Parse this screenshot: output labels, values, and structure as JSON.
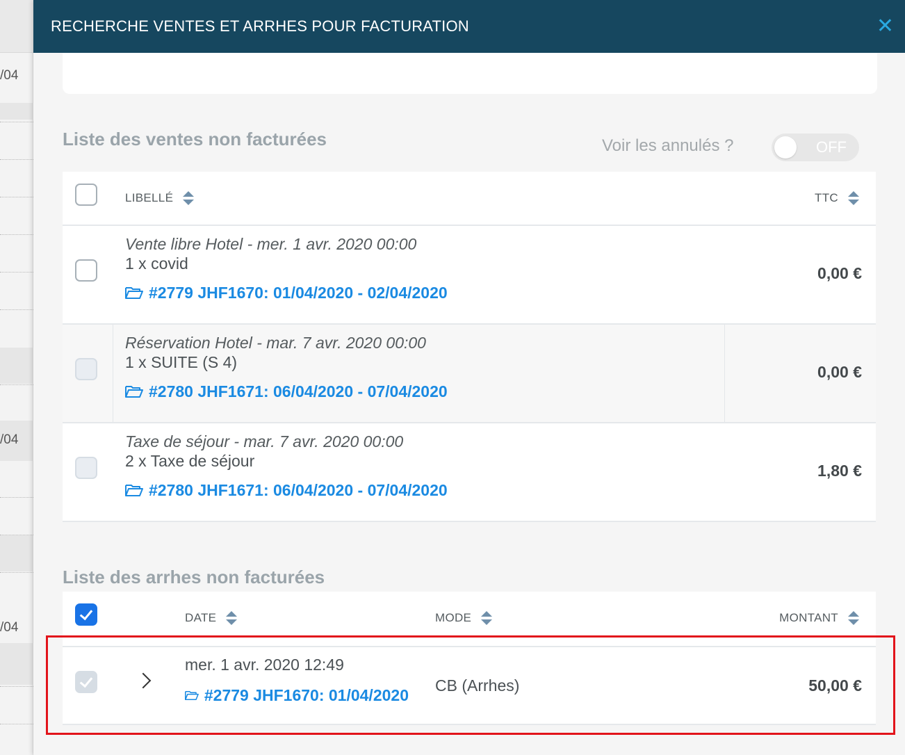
{
  "background": {
    "fragments": [
      "/04",
      "/04",
      "/04"
    ]
  },
  "modal": {
    "title": "RECHERCHE VENTES ET ARRHES POUR FACTURATION",
    "close_icon": "close-icon"
  },
  "ventes": {
    "section_title": "Liste des ventes non facturées",
    "toggle_label": "Voir les annulés ?",
    "toggle_state": "OFF",
    "headers": {
      "libelle": "LIBELLÉ",
      "ttc": "TTC"
    },
    "rows": [
      {
        "title": "Vente libre Hotel - mer. 1 avr. 2020 00:00",
        "detail": "1 x covid",
        "link": "#2779 JHF1670: 01/04/2020 - 02/04/2020",
        "amount": "0,00 €"
      },
      {
        "title": "Réservation Hotel - mar. 7 avr. 2020 00:00",
        "detail": "1 x SUITE (S 4)",
        "link": "#2780 JHF1671: 06/04/2020 - 07/04/2020",
        "amount": "0,00 €"
      },
      {
        "title": "Taxe de séjour - mar. 7 avr. 2020 00:00",
        "detail": "2 x Taxe de séjour",
        "link": "#2780 JHF1671: 06/04/2020 - 07/04/2020",
        "amount": "1,80 €"
      }
    ]
  },
  "arrhes": {
    "section_title": "Liste des arrhes non facturées",
    "headers": {
      "date": "DATE",
      "mode": "MODE",
      "montant": "MONTANT"
    },
    "rows": [
      {
        "date": "mer. 1 avr. 2020 12:49",
        "link": "#2779 JHF1670: 01/04/2020",
        "mode": "CB (Arrhes)",
        "amount": "50,00 €"
      }
    ]
  },
  "colors": {
    "header_bg": "#16475f",
    "link": "#1a8ae2",
    "highlight_border": "#e2141b",
    "checkbox_checked": "#1973e6"
  }
}
